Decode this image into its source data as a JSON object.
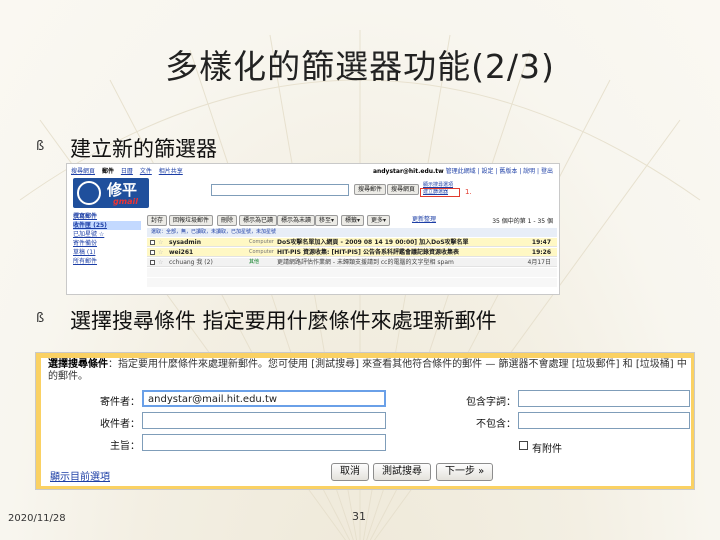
{
  "slide": {
    "title": "多樣化的篩選器功能(2/3)",
    "bullets": [
      {
        "mark": "ß",
        "text": "建立新的篩選器"
      },
      {
        "mark": "ß",
        "text": "選擇搜尋條件 指定要用什麼條件來處理新郵件"
      }
    ],
    "footer_date": "2020/11/28",
    "page_number": "31"
  },
  "gmail_inbox": {
    "top_nav": [
      "搜尋網頁",
      "郵件",
      "日曆",
      "文件",
      "相片共享"
    ],
    "user_email": "andystar@hit.edu.tw",
    "user_links": "管理此網域 | 設定 | 舊版本 | 說明 | 登出",
    "logo_main": "修平",
    "logo_sub": "gmail",
    "search_mail_button": "搜尋郵件",
    "search_web_button": "搜尋網頁",
    "search_links": [
      "顯示搜尋選項",
      "建立篩選器"
    ],
    "annotation_label": "1.",
    "sidebar": {
      "compose": "撰寫郵件",
      "items": [
        {
          "label": "收件匣 (25)",
          "selected": true
        },
        {
          "label": "已加星號 ☆",
          "selected": false
        },
        {
          "label": "寄件備份",
          "selected": false
        },
        {
          "label": "草稿 (1)",
          "selected": false
        },
        {
          "label": "所有郵件",
          "selected": false
        }
      ]
    },
    "toolbar": [
      "封存",
      "回報垃圾郵件",
      "刪除",
      "標示為已讀",
      "標示為未讀",
      "移至▾",
      "標籤▾",
      "更多▾",
      "重新整理"
    ],
    "pager": {
      "range": "35 個中的第 1 - 35 個",
      "link": "更新整理"
    },
    "select_line": "選取：全部，無，已讀取，未讀取，已加星號，未加星號",
    "rows": [
      {
        "from": "sysadmin",
        "tag": "Computer",
        "subject": "DoS攻擊名單加入網頁 - 2009 08 14 19 00:00] 加入DoS攻擊名單",
        "date": "19:47",
        "unread": true
      },
      {
        "from": "wei261",
        "tag": "Computer",
        "subject": "HIT-PIS 資源收集: [HIT-PIS] 公告各系科評鑑會議記錄資源收集表",
        "date": "19:26",
        "unread": true
      },
      {
        "from": "cchuang 我 (2)",
        "tag": "其他",
        "subject": "更請網路評估作業網 - 未歸類支援請到 cc的電腦的文字型相 spam",
        "date": "4月17日",
        "unread": false
      }
    ]
  },
  "filter_form": {
    "description_bold": "選擇搜尋條件",
    "description": "：指定要用什麼條件來處理新郵件。您可使用 [測試搜尋] 來查看其他符合條件的郵件 — 篩選器不會處理 [垃圾郵件] 和 [垃圾桶] 中的郵件。",
    "from_label": "寄件者：",
    "from_value": "andystar@mail.hit.edu.tw",
    "to_label": "收件者：",
    "subject_label": "主旨：",
    "has_words_label": "包含字詞：",
    "doesnt_have_label": "不包含：",
    "has_attachment_label": "有附件",
    "show_options_link": "顯示目前選項",
    "cancel_button": "取消",
    "test_search_button": "測試搜尋",
    "next_step_button": "下一步 »"
  }
}
